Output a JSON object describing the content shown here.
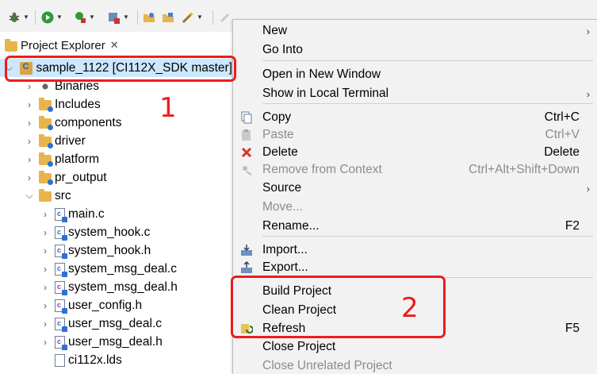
{
  "toolbar": {
    "buttons": [
      {
        "name": "debug-icon"
      },
      {
        "name": "run-icon"
      },
      {
        "name": "external-tools-icon"
      },
      {
        "name": "build-target-icon"
      },
      {
        "name": "open-folder-icon"
      },
      {
        "name": "open-project-icon"
      },
      {
        "name": "wand-icon"
      }
    ]
  },
  "explorer": {
    "tab_title": "Project Explorer",
    "close_glyph": "✕",
    "project_label": "sample_1122 [CI112X_SDK master]",
    "items": [
      {
        "label": "Binaries",
        "kind": "binaries"
      },
      {
        "label": "Includes",
        "kind": "folder"
      },
      {
        "label": "components",
        "kind": "folder"
      },
      {
        "label": "driver",
        "kind": "folder"
      },
      {
        "label": "platform",
        "kind": "folder"
      },
      {
        "label": "pr_output",
        "kind": "folder"
      },
      {
        "label": "src",
        "kind": "folder-open"
      },
      {
        "label": "main.c",
        "kind": "c"
      },
      {
        "label": "system_hook.c",
        "kind": "c"
      },
      {
        "label": "system_hook.h",
        "kind": "h"
      },
      {
        "label": "system_msg_deal.c",
        "kind": "c"
      },
      {
        "label": "system_msg_deal.h",
        "kind": "h"
      },
      {
        "label": "user_config.h",
        "kind": "h"
      },
      {
        "label": "user_msg_deal.c",
        "kind": "c"
      },
      {
        "label": "user_msg_deal.h",
        "kind": "h"
      },
      {
        "label": "ci112x.lds",
        "kind": "lds"
      }
    ]
  },
  "menu": {
    "items": [
      {
        "label": "New",
        "submenu": true
      },
      {
        "label": "Go Into"
      },
      {
        "label": "Open in New Window"
      },
      {
        "label": "Show in Local Terminal",
        "submenu": true
      },
      {
        "label": "Copy",
        "shortcut": "Ctrl+C",
        "icon": "copy-icon"
      },
      {
        "label": "Paste",
        "shortcut": "Ctrl+V",
        "icon": "paste-icon",
        "disabled": true
      },
      {
        "label": "Delete",
        "shortcut": "Delete",
        "icon": "delete-icon"
      },
      {
        "label": "Remove from Context",
        "shortcut": "Ctrl+Alt+Shift+Down",
        "icon": "remove-context-icon",
        "disabled": true
      },
      {
        "label": "Source",
        "submenu": true
      },
      {
        "label": "Move...",
        "disabled": true
      },
      {
        "label": "Rename...",
        "shortcut": "F2"
      },
      {
        "label": "Import...",
        "icon": "import-icon"
      },
      {
        "label": "Export...",
        "icon": "export-icon"
      },
      {
        "label": "Build Project"
      },
      {
        "label": "Clean Project"
      },
      {
        "label": "Refresh",
        "shortcut": "F5",
        "icon": "refresh-icon"
      },
      {
        "label": "Close Project"
      },
      {
        "label": "Close Unrelated Project",
        "disabled": true
      }
    ],
    "submenu_glyph": "›"
  },
  "annotations": {
    "label_1": "1",
    "label_2": "2",
    "color": "#ee1c1c"
  },
  "colors": {
    "selection": "#cce8ff",
    "disabled_text": "#8c8c8c",
    "menu_background": "#f2f2f2"
  }
}
